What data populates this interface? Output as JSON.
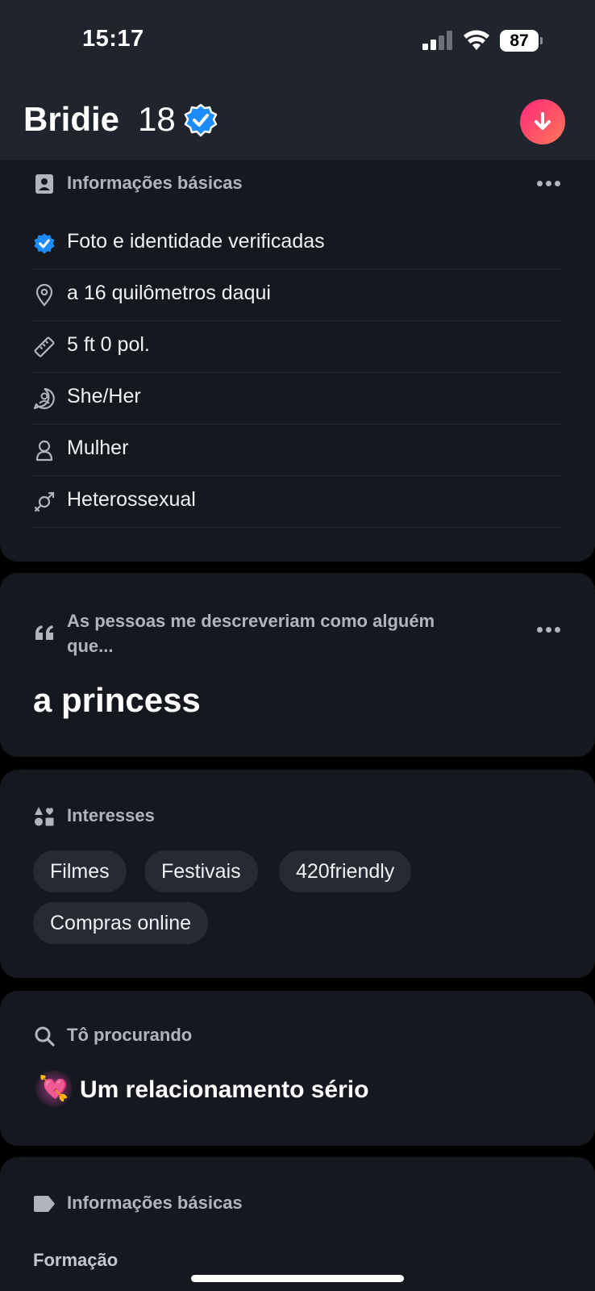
{
  "status_bar": {
    "time": "15:17",
    "battery": "87"
  },
  "profile": {
    "name": "Bridie",
    "age": "18"
  },
  "basics": {
    "title": "Informações básicas",
    "rows": [
      {
        "icon": "verified-check-icon",
        "text": "Foto e identidade verificadas"
      },
      {
        "icon": "location-pin-icon",
        "text": "a 16 quilômetros daqui"
      },
      {
        "icon": "ruler-icon",
        "text": "5 ft 0 pol."
      },
      {
        "icon": "pronoun-icon",
        "text": "She/Her"
      },
      {
        "icon": "person-icon",
        "text": "Mulher"
      },
      {
        "icon": "gender-symbol-icon",
        "text": "Heterossexual"
      }
    ]
  },
  "prompt": {
    "title": "As pessoas me descreveriam como alguém que...",
    "answer": "a princess"
  },
  "interests": {
    "title": "Interesses",
    "chips": [
      "Filmes",
      "Festivais",
      "420friendly",
      "Compras online"
    ]
  },
  "looking_for": {
    "title": "Tô procurando",
    "emoji": "💘",
    "value": "Um relacionamento sério"
  },
  "basics2": {
    "title": "Informações básicas",
    "subhead": "Formação"
  },
  "colors": {
    "accent_blue": "#1d8cf8",
    "brand_gradient_start": "#fd267d",
    "brand_gradient_end": "#ff7854"
  }
}
